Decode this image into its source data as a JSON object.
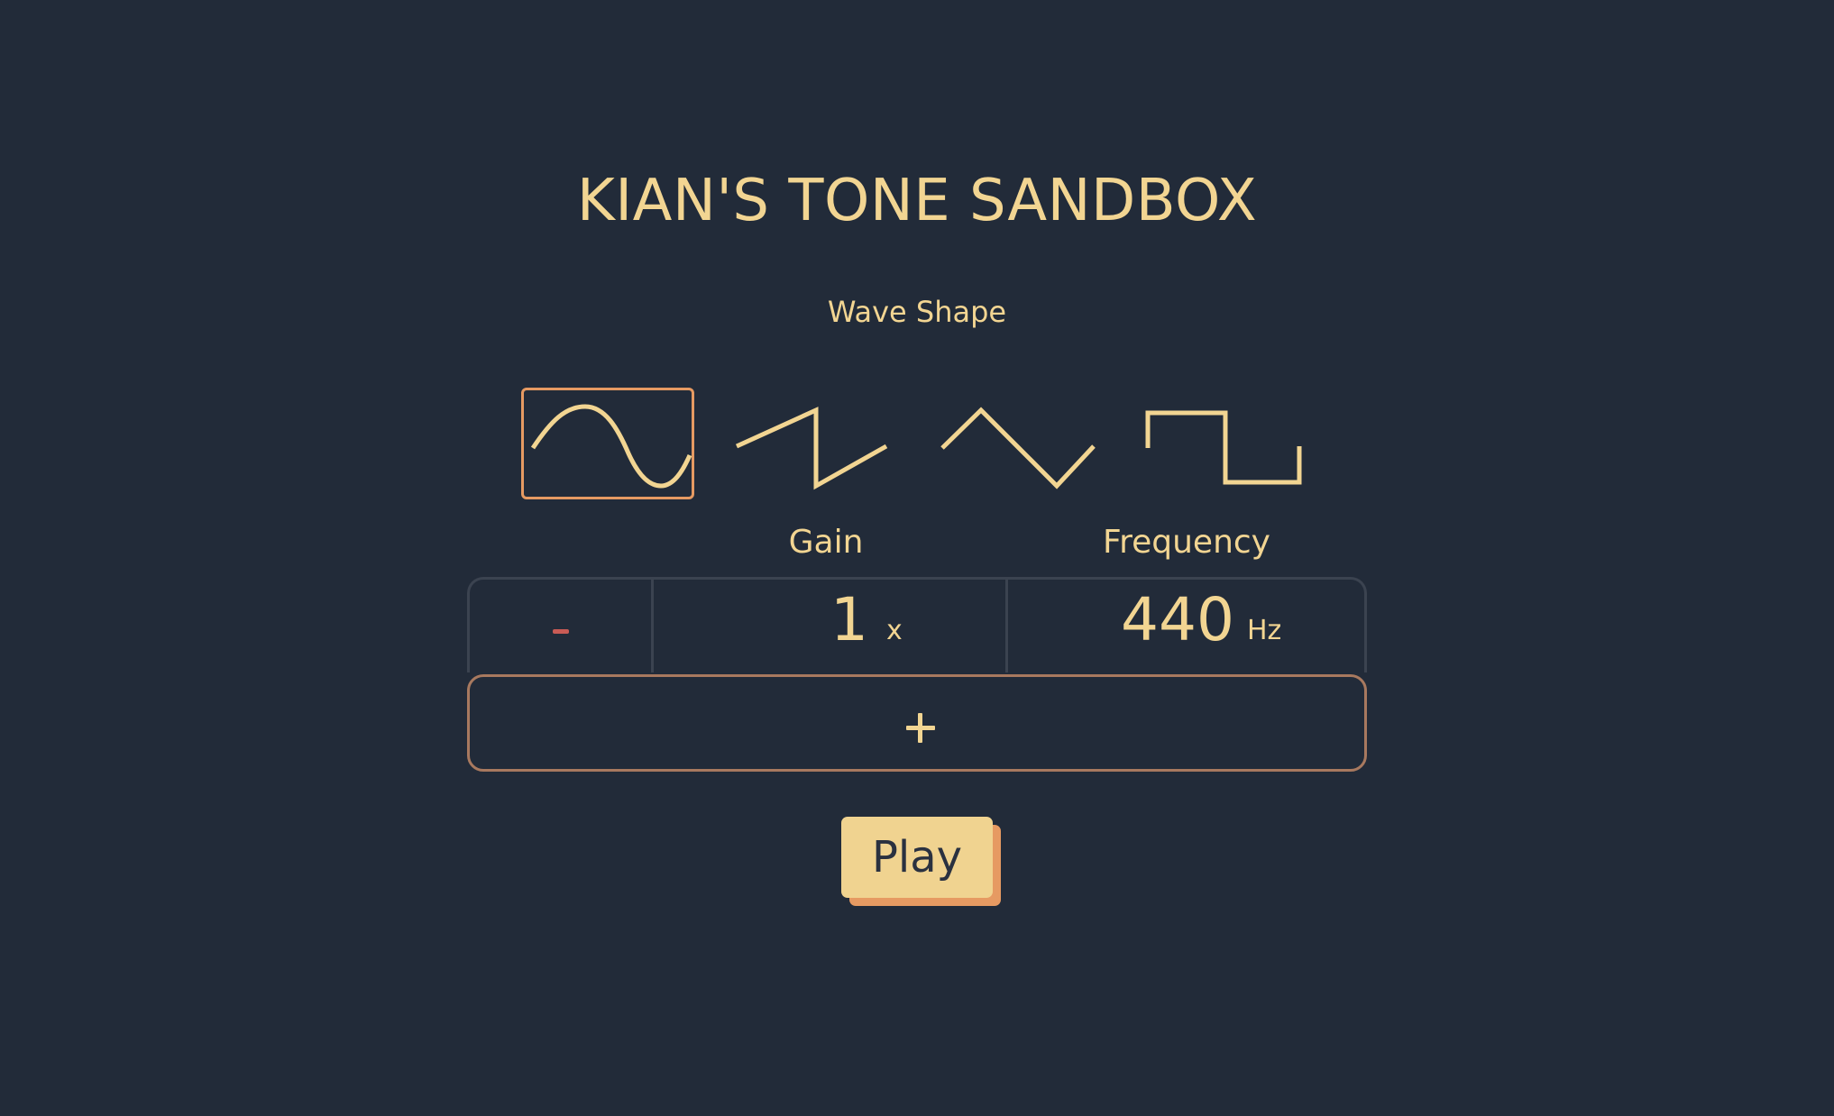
{
  "app": {
    "title": "KIAN'S TONE SANDBOX"
  },
  "wave_shape": {
    "label": "Wave Shape",
    "options": [
      {
        "name": "sine",
        "icon": "sine-wave-icon",
        "selected": true
      },
      {
        "name": "sawtooth",
        "icon": "sawtooth-wave-icon",
        "selected": false
      },
      {
        "name": "triangle",
        "icon": "triangle-wave-icon",
        "selected": false
      },
      {
        "name": "square",
        "icon": "square-wave-icon",
        "selected": false
      }
    ]
  },
  "controls": {
    "minus_label": "-",
    "gain": {
      "label": "Gain",
      "value": "1",
      "unit": "x"
    },
    "frequency": {
      "label": "Frequency",
      "value": "440",
      "unit": "Hz"
    },
    "plus_label": "+"
  },
  "play": {
    "label": "Play"
  },
  "colors": {
    "background": "#222b39",
    "text": "#f2d592",
    "accent": "#e69a62",
    "minus": "#c95b55",
    "border": "#3b4350",
    "plus_border": "#a8795f",
    "play_bg": "#f0d390"
  }
}
